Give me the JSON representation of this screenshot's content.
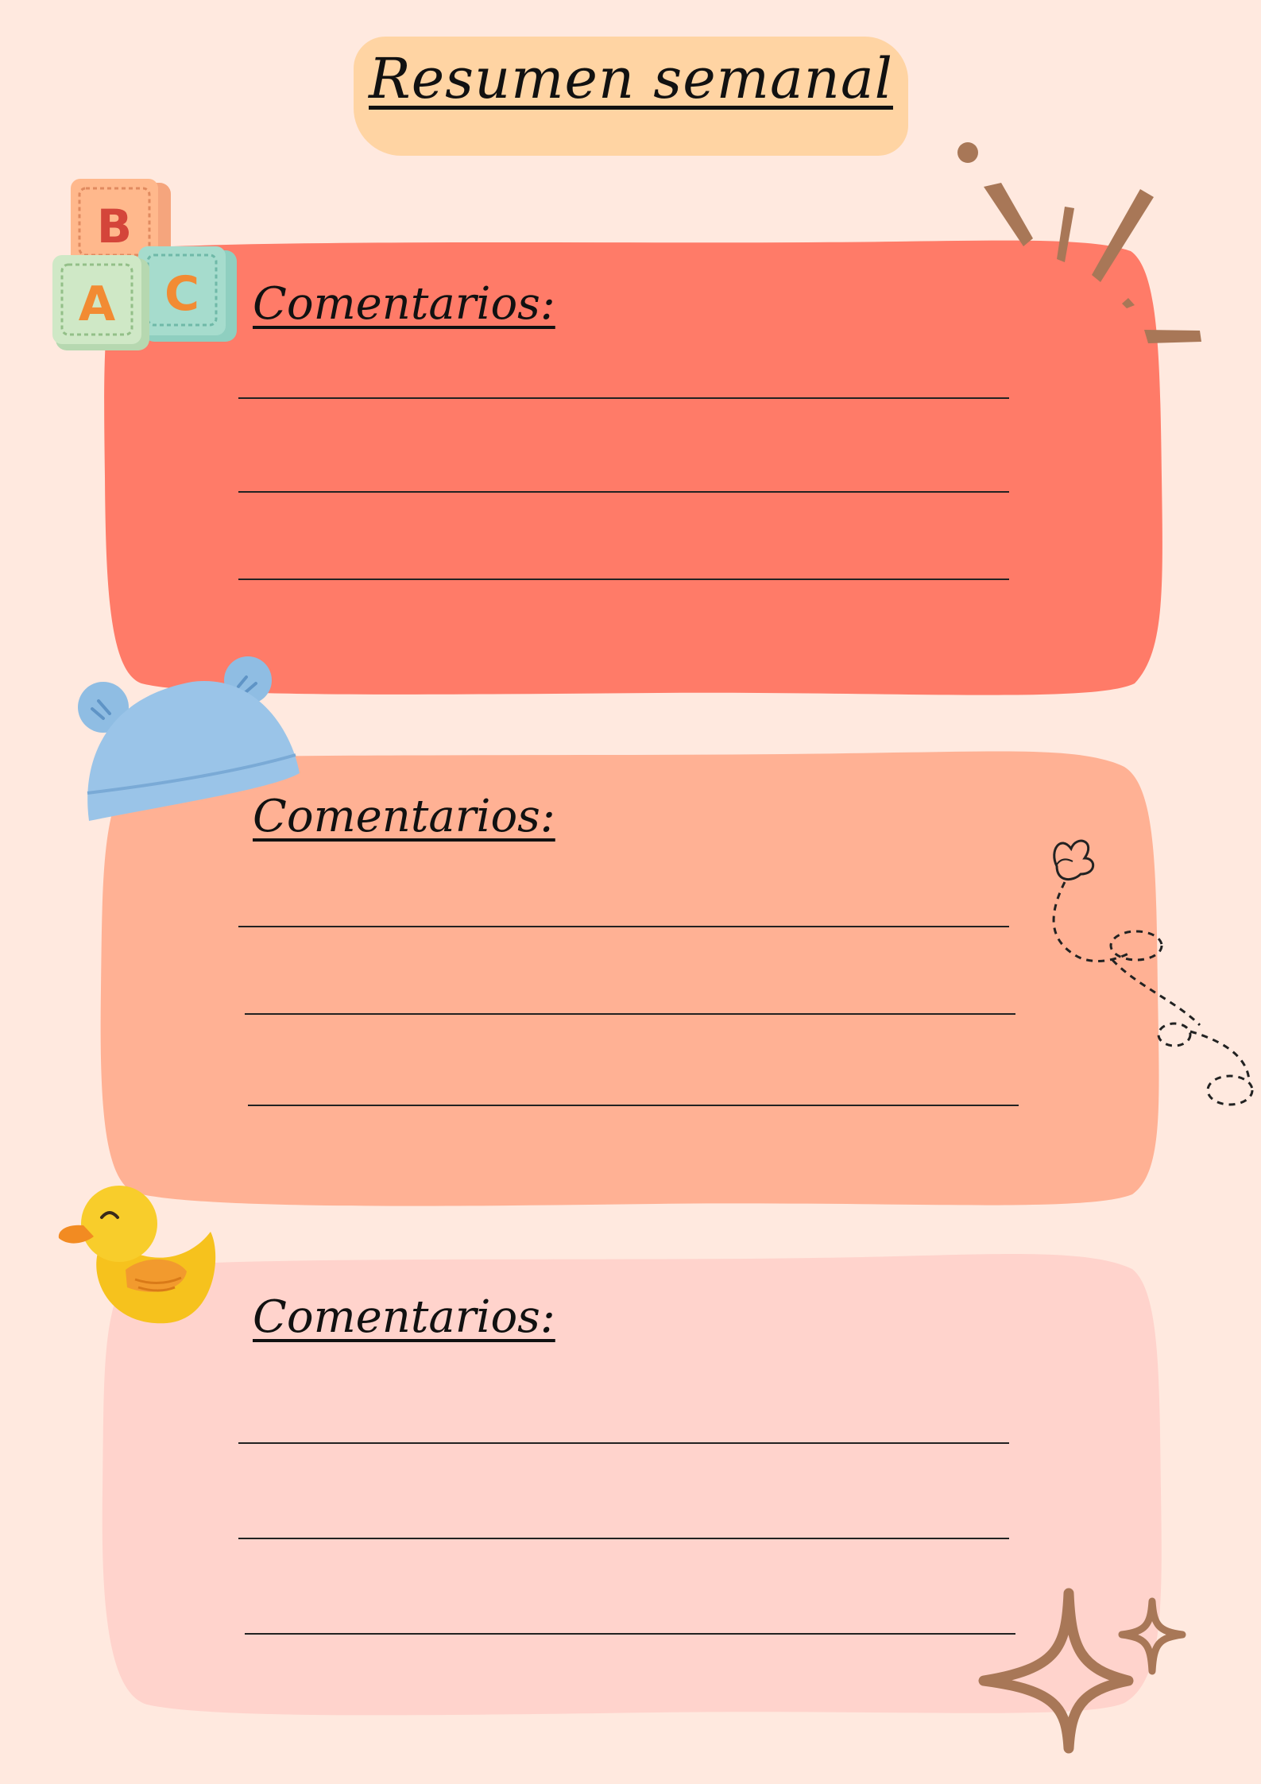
{
  "title": "Resumen semanal",
  "colors": {
    "background": "#ffe9df",
    "title_highlight": "#ffd4a3",
    "card_1": "#ff7b68",
    "card_2": "#ffb194",
    "card_3": "#ffd3cc",
    "accent_brown": "#a87757"
  },
  "cards": [
    {
      "heading": "Comentarios:",
      "lines": 3
    },
    {
      "heading": "Comentarios:",
      "lines": 3
    },
    {
      "heading": "Comentarios:",
      "lines": 3
    }
  ],
  "decorations": {
    "blocks": {
      "icon": "abc-blocks-icon",
      "letters": [
        "B",
        "A",
        "C"
      ]
    },
    "hat": {
      "icon": "baby-hat-icon"
    },
    "duck": {
      "icon": "rubber-duck-icon"
    },
    "butterfly": {
      "icon": "butterfly-icon"
    },
    "sparkle_lines": {
      "icon": "sparkle-lines-icon"
    },
    "stars": {
      "icon": "sparkle-stars-icon"
    }
  }
}
